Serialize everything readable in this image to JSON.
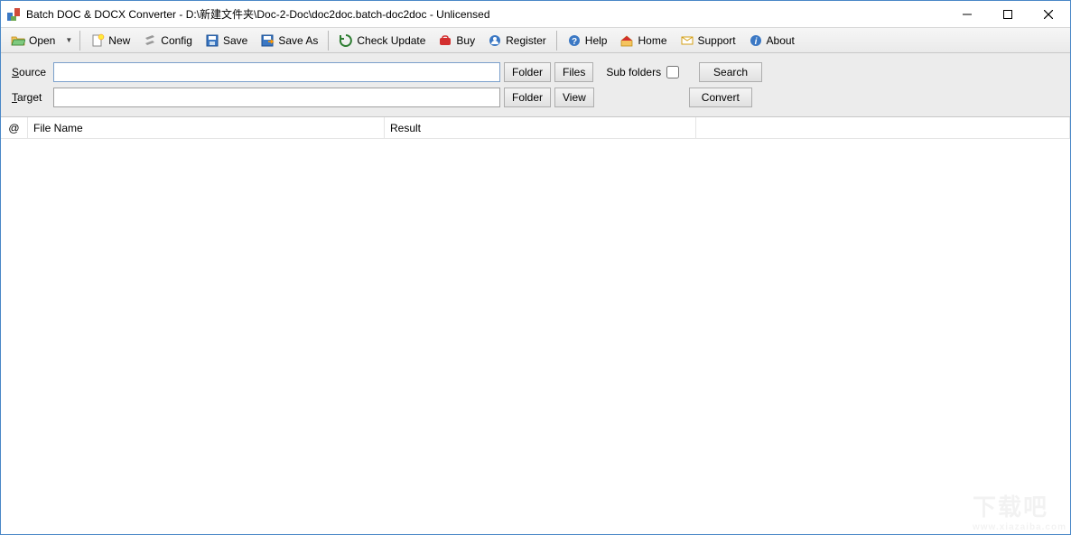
{
  "title": "Batch DOC & DOCX Converter - D:\\新建文件夹\\Doc-2-Doc\\doc2doc.batch-doc2doc - Unlicensed",
  "toolbar": {
    "open": "Open",
    "new": "New",
    "config": "Config",
    "save": "Save",
    "save_as": "Save As",
    "check_update": "Check Update",
    "buy": "Buy",
    "register": "Register",
    "help": "Help",
    "home": "Home",
    "support": "Support",
    "about": "About"
  },
  "io": {
    "source_label_pre": "S",
    "source_label_rest": "ource",
    "source_value": "",
    "target_label_pre": "T",
    "target_label_rest": "arget",
    "target_value": "",
    "folder_btn": "Folder",
    "files_btn": "Files",
    "view_btn": "View",
    "sub_folders_label": "Sub folders",
    "search_btn": "Search",
    "convert_btn": "Convert"
  },
  "columns": {
    "at": "@",
    "file_name": "File Name",
    "result": "Result"
  },
  "watermark": {
    "main": "下载吧",
    "sub": "www.xiazaiba.com"
  }
}
